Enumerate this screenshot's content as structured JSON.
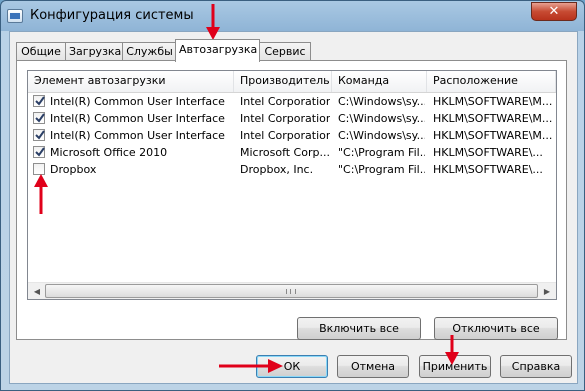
{
  "window": {
    "title": "Конфигурация системы",
    "close_glyph": "✕"
  },
  "tabs": [
    "Общие",
    "Загрузка",
    "Службы",
    "Автозагрузка",
    "Сервис"
  ],
  "table": {
    "columns": [
      "Элемент автозагрузки",
      "Производитель",
      "Команда",
      "Расположение"
    ],
    "rows": [
      {
        "checked": true,
        "name": "Intel(R) Common User Interface",
        "maker": "Intel Corporation",
        "command": "C:\\Windows\\sy...",
        "location": "HKLM\\SOFTWARE\\M..."
      },
      {
        "checked": true,
        "name": "Intel(R) Common User Interface",
        "maker": "Intel Corporation",
        "command": "C:\\Windows\\sy...",
        "location": "HKLM\\SOFTWARE\\M..."
      },
      {
        "checked": true,
        "name": "Intel(R) Common User Interface",
        "maker": "Intel Corporation",
        "command": "C:\\Windows\\sy...",
        "location": "HKLM\\SOFTWARE\\M..."
      },
      {
        "checked": true,
        "name": "Microsoft Office 2010",
        "maker": "Microsoft Corp...",
        "command": "\"C:\\Program Fil...",
        "location": "HKLM\\SOFTWARE\\..."
      },
      {
        "checked": false,
        "name": "Dropbox",
        "maker": "Dropbox, Inc.",
        "command": "\"C:\\Program Fil...",
        "location": "HKLM\\SOFTWARE\\..."
      }
    ]
  },
  "buttons": {
    "enable_all": "Включить все",
    "disable_all": "Отключить все",
    "ok": "ОК",
    "cancel": "Отмена",
    "apply": "Применить",
    "help": "Справка"
  },
  "colors": {
    "annotation_arrow": "#e0001a",
    "selection": "#3399ff"
  }
}
